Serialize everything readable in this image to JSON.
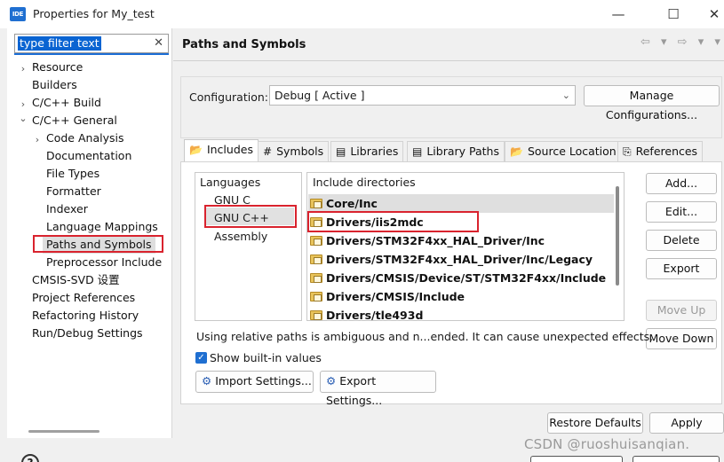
{
  "window": {
    "logo_text": "IDE",
    "title": "Properties for My_test",
    "minimize": "—",
    "maximize": "☐",
    "close": "✕"
  },
  "filter": {
    "text": "type filter text",
    "clear": "✕"
  },
  "tree": {
    "items": [
      {
        "label": "Resource",
        "arrow": "›"
      },
      {
        "label": "Builders",
        "arrow": ""
      },
      {
        "label": "C/C++ Build",
        "arrow": "›"
      },
      {
        "label": "C/C++ General",
        "arrow": "⌄"
      },
      {
        "label": "Code Analysis",
        "arrow": "›"
      },
      {
        "label": "Documentation",
        "arrow": ""
      },
      {
        "label": "File Types",
        "arrow": ""
      },
      {
        "label": "Formatter",
        "arrow": ""
      },
      {
        "label": "Indexer",
        "arrow": ""
      },
      {
        "label": "Language Mappings",
        "arrow": ""
      },
      {
        "label": "Paths and Symbols",
        "arrow": ""
      },
      {
        "label": "Preprocessor Include",
        "arrow": ""
      },
      {
        "label": "CMSIS-SVD 设置",
        "arrow": ""
      },
      {
        "label": "Project References",
        "arrow": ""
      },
      {
        "label": "Refactoring History",
        "arrow": ""
      },
      {
        "label": "Run/Debug Settings",
        "arrow": ""
      }
    ]
  },
  "header": {
    "title": "Paths and Symbols",
    "nav": "⇦ ▾ ⇨ ▾ ▾"
  },
  "config": {
    "label": "Configuration:",
    "value": "Debug  [ Active ]",
    "arrow": "⌄",
    "manage_button": "Manage Configurations..."
  },
  "tabs": [
    {
      "label": "Includes",
      "icon": "📂"
    },
    {
      "label": "Symbols",
      "icon": "#"
    },
    {
      "label": "Libraries",
      "icon": "▤"
    },
    {
      "label": "Library Paths",
      "icon": "▤"
    },
    {
      "label": "Source Location",
      "icon": "📂"
    },
    {
      "label": "References",
      "icon": "⎘"
    }
  ],
  "languages": {
    "heading": "Languages",
    "items": [
      "GNU C",
      "GNU C++",
      "Assembly"
    ]
  },
  "directories": {
    "heading": "Include directories",
    "items": [
      "Core/Inc",
      "Drivers/iis2mdc",
      "Drivers/STM32F4xx_HAL_Driver/Inc",
      "Drivers/STM32F4xx_HAL_Driver/Inc/Legacy",
      "Drivers/CMSIS/Device/ST/STM32F4xx/Include",
      "Drivers/CMSIS/Include",
      "Drivers/tle493d"
    ]
  },
  "side_buttons": {
    "add": "Add...",
    "edit": "Edit...",
    "delete": "Delete",
    "export": "Export",
    "move_up": "Move Up",
    "move_down": "Move Down"
  },
  "notice": "Using relative paths is ambiguous and n...ended. It can cause unexpected effects.",
  "show_builtin": "Show built-in values",
  "import_settings": "Import Settings...",
  "export_settings": "Export Settings...",
  "restore_defaults": "Restore Defaults",
  "apply": "Apply",
  "watermark": "CSDN @ruoshuisanqian.",
  "help": "?"
}
